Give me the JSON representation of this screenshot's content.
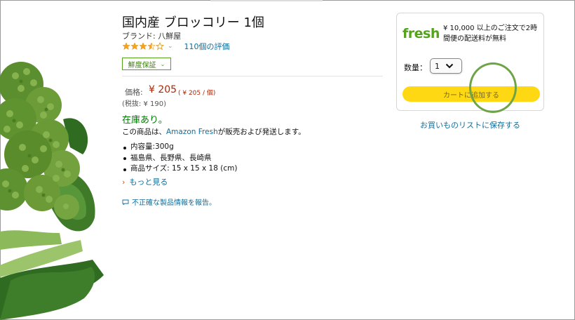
{
  "product": {
    "title": "国内産 ブロッコリー 1個",
    "brand": "ブランド: 八鮮屋",
    "rating_count": "110個の評価",
    "rating_caret": "⌄",
    "badge": "鮮度保証",
    "badge_caret": "⌄",
    "price_label": "価格:",
    "price": "¥ 205",
    "unit_price": "( ¥ 205 / 個)",
    "tax_excluded": "(税抜: ¥ 190)",
    "stock": "在庫あり。",
    "sold_by_prefix": "この商品は、",
    "sold_by_link": "Amazon Fresh",
    "sold_by_suffix": "が販売および発送します。",
    "bullets": [
      "内容量:300g",
      "福島県、長野県、長崎県",
      "商品サイズ: 15 x 15 x 18 (cm)"
    ],
    "more": "もっと見る",
    "more_caret": "›",
    "report": "不正確な製品情報を報告。"
  },
  "buybox": {
    "logo": "fresh",
    "shipping": "¥ 10,000 以上のご注文で2時間便の配送料が無料",
    "qty_label": "数量：",
    "qty_value": "1",
    "add_to_cart": "カートに追加する",
    "wishlist": "お買いものリストに保存する"
  },
  "colors": {
    "price": "#b12704",
    "link": "#0f6e9c",
    "fresh_green": "#55a31b",
    "cart_button": "#ffd814",
    "star": "#f7a21a"
  },
  "icons": {
    "rating": "star-icon",
    "quantity": "chevron-down-icon",
    "more": "chevron-right-icon",
    "report": "chat-bubble-icon"
  }
}
